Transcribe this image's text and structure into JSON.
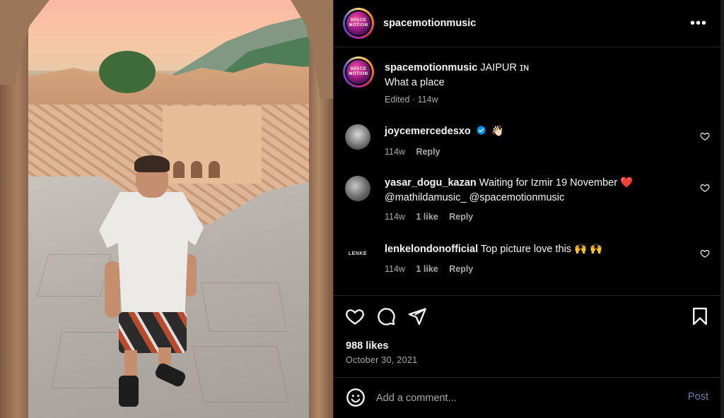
{
  "post": {
    "author": "spacemotionmusic",
    "avatar_text": "SPACE MOTION",
    "more_label": "•••"
  },
  "caption": {
    "author": "spacemotionmusic",
    "location": "JAIPUR ɪɴ",
    "text": "What a place",
    "meta": "Edited · 114w"
  },
  "comments": [
    {
      "user": "joycemercedesxo",
      "verified": true,
      "text": "👋🏻",
      "age": "114w",
      "likes": "",
      "reply": "Reply"
    },
    {
      "user": "yasar_dogu_kazan",
      "text": "Waiting for Izmir 19 November ❤️",
      "text2": "@mathildamusic_ @spacemotionmusic",
      "age": "114w",
      "likes": "1 like",
      "reply": "Reply"
    },
    {
      "user": "lenkelondonofficial",
      "avatar_text": "LENKE",
      "text": "Top picture love this 🙌 🙌",
      "age": "114w",
      "likes": "1 like",
      "reply": "Reply"
    }
  ],
  "stats": {
    "likes": "988 likes",
    "date": "October 30, 2021"
  },
  "composer": {
    "placeholder": "Add a comment...",
    "post_label": "Post"
  },
  "icons": [
    "more-icon",
    "heart-icon",
    "comment-icon",
    "share-icon",
    "bookmark-icon",
    "emoji-icon",
    "verified-icon"
  ],
  "colors": {
    "background": "#000000",
    "text": "#f5f5f5",
    "muted": "#a8a8a8",
    "verified": "#0095f6",
    "post_disabled": "#6b7fa8",
    "divider": "#262626"
  }
}
